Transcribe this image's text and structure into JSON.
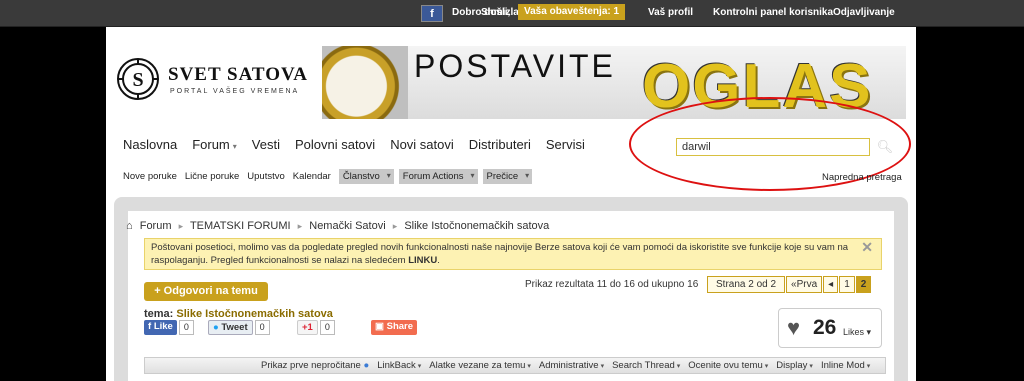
{
  "topbar": {
    "avatar_icon": "facebook-avatar-icon",
    "welcome": "Dobro došli,",
    "username": "Shmizla",
    "notifications": "Vaša obaveštenja: 1",
    "profile": "Vaš profil",
    "control_panel": "Kontrolni panel korisnika",
    "logout": "Odjavljivanje"
  },
  "logo": {
    "name": "SVET SATOVA",
    "tagline": "PORTAL VAŠEG VREMENA"
  },
  "banner": {
    "title": "POSTAVITE",
    "big": "OGLAS"
  },
  "nav": {
    "items": [
      "Naslovna",
      "Forum",
      "Vesti",
      "Polovni satovi",
      "Novi satovi",
      "Distributeri",
      "Servisi"
    ]
  },
  "search": {
    "value": "darwil",
    "advanced": "Napredna pretraga"
  },
  "subnav": {
    "items": [
      "Nove poruke",
      "Lične poruke",
      "Uputstvo",
      "Kalendar"
    ],
    "dropdowns": [
      "Članstvo",
      "Forum Actions",
      "Prečice"
    ]
  },
  "breadcrumb": [
    "Forum",
    "TEMATSKI FORUMI",
    "Nemački Satovi",
    "Slike Istočnonemačkih satova"
  ],
  "notice": {
    "text": "Poštovani posetioci, molimo vas da pogledate pregled novih funkcionalnosti naše najnovije Berze satova koji će vam pomoći da iskoristite sve funkcije koje su vam na raspolaganju. Pregled funkcionalnosti se nalazi na sledećem ",
    "link": "LINKU",
    "end": "."
  },
  "thread": {
    "reply_button": "+ Odgovori na temu",
    "results": "Prikaz rezultata 11 do 16 od ukupno 16",
    "label": "tema:",
    "title": "Slike Istočnonemačkih satova"
  },
  "pager": {
    "page_of": "Strana 2 od 2",
    "first": "Prva",
    "prev": "◂",
    "pages": [
      "1",
      "2"
    ],
    "current": "2"
  },
  "social": {
    "like": "Like",
    "like_count": "0",
    "tweet": "Tweet",
    "tweet_count": "0",
    "gplus": "+1",
    "gplus_count": "0",
    "share": "Share"
  },
  "likes": {
    "count": "26",
    "label": "Likes"
  },
  "toolbar": {
    "first_unread": "Prikaz prve nepročitane",
    "items": [
      "LinkBack",
      "Alatke vezane za temu",
      "Administrative",
      "Search Thread",
      "Ocenite ovu temu",
      "Display",
      "Inline Mod"
    ]
  },
  "colors": {
    "accent": "#c9a11d",
    "highlight_oval": "#dd1111"
  }
}
